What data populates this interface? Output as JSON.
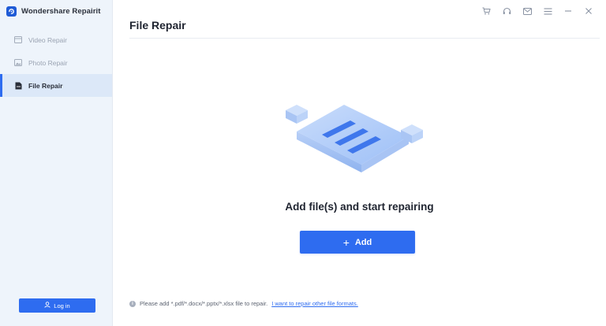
{
  "app": {
    "name": "Wondershare Repairit"
  },
  "sidebar": {
    "items": [
      {
        "label": "Video Repair",
        "icon": "video-icon",
        "active": false
      },
      {
        "label": "Photo Repair",
        "icon": "image-icon",
        "active": false
      },
      {
        "label": "File Repair",
        "icon": "file-icon",
        "active": true
      }
    ],
    "login_label": "Log in"
  },
  "toolbar": {
    "icons": [
      "cart-icon",
      "headset-icon",
      "mail-icon",
      "menu-icon",
      "minimize-icon",
      "close-icon"
    ]
  },
  "main": {
    "title": "File Repair",
    "headline": "Add file(s) and start repairing",
    "add_label": "Add",
    "add_plus": "+",
    "hint_text": "Please add *.pdf/*.docx/*.pptx/*.xlsx file to repair.",
    "hint_link": "I want to repair other file formats."
  },
  "colors": {
    "accent": "#2e6cf0",
    "sidebar_bg": "#eef4fb",
    "active_item_bg": "#dce8f8"
  }
}
